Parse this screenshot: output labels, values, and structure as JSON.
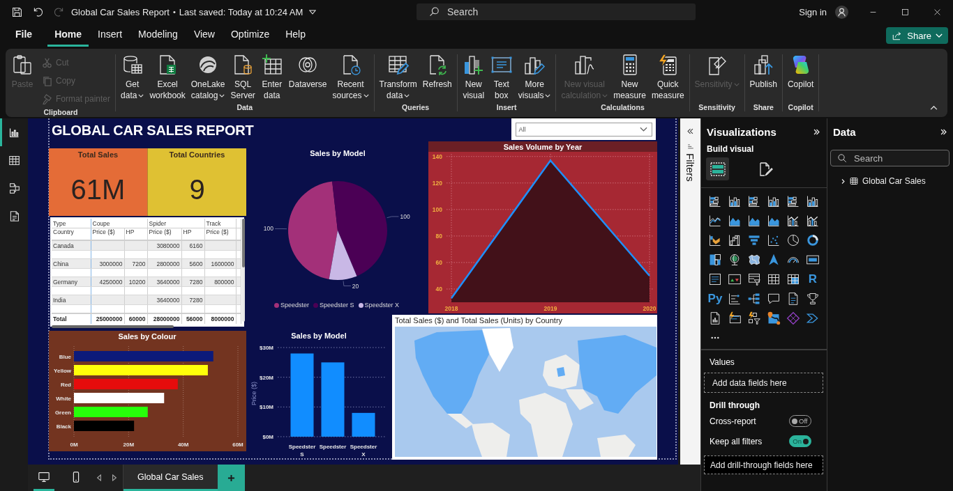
{
  "title_bar": {
    "quick_access": [
      {
        "disabled": false
      },
      {
        "disabled": false
      },
      {
        "disabled": true
      }
    ],
    "file_name": "Global Car Sales Report",
    "separator": "•",
    "status": "Last saved: Today at 10:24 AM",
    "search": {
      "placeholder": "Search"
    },
    "sign_in": "Sign in"
  },
  "menu": [
    {
      "label": "File",
      "selected": false
    },
    {
      "label": "Home",
      "selected": true
    },
    {
      "label": "Insert",
      "selected": false
    },
    {
      "label": "Modeling",
      "selected": false
    },
    {
      "label": "View",
      "selected": false
    },
    {
      "label": "Optimize",
      "selected": false
    },
    {
      "label": "Help",
      "selected": false
    }
  ],
  "share_button": {
    "label": "Share"
  },
  "ribbon": {
    "groups": [
      {
        "label": "Clipboard",
        "buttons": [
          {
            "label": "Paste",
            "dropdown": false,
            "disabled": true
          }
        ],
        "small_buttons": [
          {
            "label": "Cut",
            "disabled": true
          },
          {
            "label": "Copy",
            "disabled": true
          },
          {
            "label": "Format painter",
            "disabled": true
          }
        ]
      },
      {
        "label": "Data",
        "buttons": [
          {
            "label": "Get\ndata",
            "dropdown": true,
            "disabled": false
          },
          {
            "label": "Excel\nworkbook",
            "dropdown": false,
            "disabled": false
          },
          {
            "label": "OneLake\ncatalog",
            "dropdown": true,
            "disabled": false
          },
          {
            "label": "SQL\nServer",
            "dropdown": false,
            "disabled": false
          },
          {
            "label": "Enter\ndata",
            "dropdown": false,
            "disabled": false
          },
          {
            "label": "Dataverse",
            "dropdown": false,
            "disabled": false
          },
          {
            "label": "Recent\nsources",
            "dropdown": true,
            "disabled": false
          }
        ]
      },
      {
        "label": "Queries",
        "buttons": [
          {
            "label": "Transform\ndata",
            "dropdown": true,
            "disabled": false
          },
          {
            "label": "Refresh",
            "dropdown": false,
            "disabled": false
          }
        ]
      },
      {
        "label": "Insert",
        "buttons": [
          {
            "label": "New\nvisual",
            "dropdown": false,
            "disabled": false
          },
          {
            "label": "Text\nbox",
            "dropdown": false,
            "disabled": false
          },
          {
            "label": "More\nvisuals",
            "dropdown": true,
            "disabled": false
          }
        ]
      },
      {
        "label": "Calculations",
        "buttons": [
          {
            "label": "New visual\ncalculation",
            "dropdown": true,
            "disabled": true
          },
          {
            "label": "New\nmeasure",
            "dropdown": false,
            "disabled": false
          },
          {
            "label": "Quick\nmeasure",
            "dropdown": false,
            "disabled": false
          }
        ]
      },
      {
        "label": "Sensitivity",
        "buttons": [
          {
            "label": "Sensitivity",
            "dropdown": true,
            "disabled": true
          }
        ]
      },
      {
        "label": "Share",
        "buttons": [
          {
            "label": "Publish",
            "dropdown": false,
            "disabled": false
          }
        ]
      },
      {
        "label": "Copilot",
        "buttons": [
          {
            "label": "Copilot",
            "dropdown": false,
            "disabled": false
          }
        ]
      }
    ]
  },
  "views": [
    {
      "selected": true
    },
    {
      "selected": false
    },
    {
      "selected": false
    },
    {
      "selected": false
    }
  ],
  "report": {
    "title": "GLOBAL CAR SALES REPORT",
    "slicer": {
      "value": "All"
    },
    "cards": [
      {
        "label": "Total Sales",
        "value": "61M",
        "color": "#e46c37"
      },
      {
        "label": "Total Countries",
        "value": "9",
        "color": "#dfc133"
      }
    ],
    "matrix": {
      "column_field": "Type",
      "row_field": "Country",
      "groups": [
        {
          "label": "Coupe",
          "columns": [
            "Price ($)",
            "HP"
          ]
        },
        {
          "label": "Spider",
          "columns": [
            "Price ($)",
            "HP"
          ]
        },
        {
          "label": "Track",
          "columns": [
            "Price ($)"
          ]
        }
      ],
      "rows": [
        {
          "label": "Canada",
          "cells": [
            null,
            null,
            "3080000",
            "6160",
            null
          ]
        },
        {
          "label": "China",
          "cells": [
            "3000000",
            "7200",
            "2800000",
            "5600",
            "1600000"
          ]
        },
        {
          "label": "Germany",
          "cells": [
            "4250000",
            "10200",
            "3640000",
            "7280",
            "800000"
          ]
        },
        {
          "label": "India",
          "cells": [
            null,
            null,
            "3640000",
            "7280",
            null
          ]
        }
      ],
      "total": {
        "label": "Total",
        "cells": [
          "25000000",
          "60000",
          "28000000",
          "56000",
          "8000000"
        ]
      }
    },
    "model_pie": {
      "chart_data": {
        "type": "pie",
        "title": "Sales by Model",
        "categories": [
          "Speedster",
          "Speedster S",
          "Speedster X"
        ],
        "values": [
          100,
          100,
          20
        ],
        "colors": [
          "#a33079",
          "#4b0055",
          "#c9b8e6"
        ],
        "data_labels": true,
        "legend": "bottom"
      }
    },
    "volume_chart": {
      "chart_data": {
        "type": "area",
        "title": "Sales Volume by Year",
        "x": [
          "2018",
          "2019",
          "2020"
        ],
        "values": [
          33,
          137,
          50
        ],
        "ylim": [
          30,
          143
        ],
        "yticks": [
          40,
          60,
          80,
          100,
          120,
          140
        ],
        "grid": true
      }
    },
    "colour_chart": {
      "chart_data": {
        "type": "bar",
        "orientation": "horizontal",
        "title": "Sales by Colour",
        "categories": [
          "Blue",
          "Yellow",
          "Red",
          "White",
          "Green",
          "Black"
        ],
        "values": [
          51,
          49,
          38,
          33,
          27,
          22
        ],
        "colors": [
          "#0d1a7a",
          "#ffff0a",
          "#e60c0c",
          "#ffffff",
          "#27ff0a",
          "#000000"
        ],
        "xlim": [
          0,
          60
        ],
        "xticks": [
          {
            "value": 0,
            "label": "0M"
          },
          {
            "value": 20,
            "label": "20M"
          },
          {
            "value": 40,
            "label": "40M"
          },
          {
            "value": 60,
            "label": "60M"
          }
        ],
        "grid": true
      }
    },
    "model_columns": {
      "chart_data": {
        "type": "bar",
        "orientation": "vertical",
        "title": "Sales by Model",
        "ylabel": "Price ($)",
        "categories": [
          "Speedster S",
          "Speedster",
          "Speedster X"
        ],
        "values": [
          28,
          25,
          8
        ],
        "ylim": [
          0,
          30
        ],
        "yticks": [
          {
            "value": 0,
            "label": "$0M"
          },
          {
            "value": 10,
            "label": "$10M"
          },
          {
            "value": 20,
            "label": "$20M"
          },
          {
            "value": 30,
            "label": "$30M"
          }
        ],
        "grid": true
      }
    },
    "map": {
      "title": "Total Sales ($) and Total Sales (Units) by Country"
    }
  },
  "filters": {
    "label": "Filters"
  },
  "bottom_bar": {
    "layout_views": [
      {
        "selected": true
      },
      {
        "selected": false
      }
    ],
    "page_tabs": [
      {
        "label": "Global Car Sales",
        "selected": true
      }
    ]
  },
  "visualizations": {
    "title": "Visualizations",
    "section": "Build visual",
    "modes": [
      {
        "selected": true
      },
      {
        "selected": false
      }
    ],
    "gallery_glyphs": [
      "R",
      "Py"
    ],
    "values_well": {
      "label": "Values",
      "placeholder": "Add data fields here"
    },
    "drill_through": {
      "title": "Drill through",
      "toggles": [
        {
          "label": "Cross-report",
          "on": false,
          "state_text": "Off"
        },
        {
          "label": "Keep all filters",
          "on": true,
          "state_text": "On"
        }
      ],
      "placeholder": "Add drill-through fields here"
    }
  },
  "data_pane": {
    "title": "Data",
    "search": {
      "placeholder": "Search"
    },
    "tables": [
      {
        "name": "Global Car Sales",
        "expanded": false
      }
    ]
  }
}
